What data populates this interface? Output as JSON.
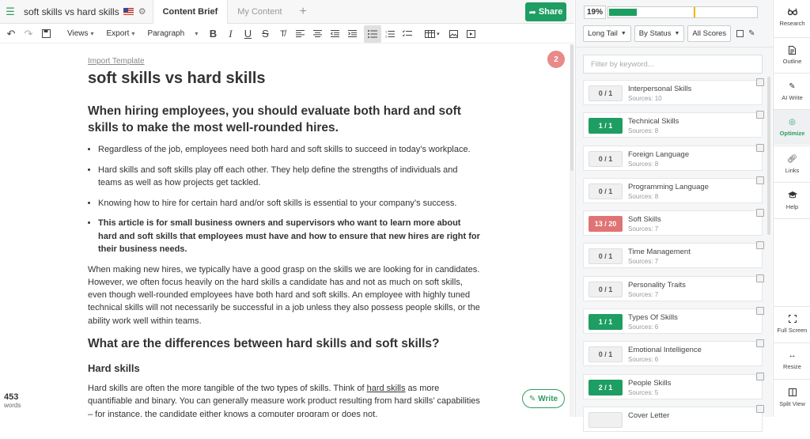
{
  "doc": {
    "title": "soft skills vs hard skills",
    "tabs": [
      "Content Brief",
      "My Content"
    ],
    "active_tab": 0,
    "share_label": "Share"
  },
  "toolbar": {
    "views_label": "Views",
    "export_label": "Export",
    "paragraph_label": "Paragraph"
  },
  "editor": {
    "import_link": "Import Template",
    "h1": "soft skills vs hard skills",
    "h2a": "When hiring employees, you should evaluate both hard and soft skills to make the most well-rounded hires.",
    "bullets": [
      "Regardless of the job, employees need both hard and soft skills to succeed in today’s workplace.",
      "Hard skills and soft skills play off each other. They help define the strengths of individuals and teams as well as how projects get tackled.",
      "Knowing how to hire for certain hard and/or soft skills is essential to your company’s success.",
      "This article is for small business owners and supervisors who want to learn more about hard and soft skills that employees must have and how to ensure that new hires are right for their business needs."
    ],
    "para1": "When making new hires, we typically have a good grasp on the skills we are looking for in candidates. However, we often focus heavily on the hard skills a candidate has and not as much on soft skills, even though well-rounded employees have both hard and soft skills. An employee with highly tuned technical skills will not necessarily be successful in a job unless they also possess people skills, or the ability work well within teams.",
    "h2b": "What are the differences between hard skills and soft skills?",
    "h3": "Hard skills",
    "para2_pre": "Hard skills are often the more tangible of the two types of skills. Think of ",
    "para2_link": "hard skills",
    "para2_post": " as more quantifiable and binary. You can generally measure work product resulting from hard skills’ capabilities – for instance, the candidate either knows a computer program or does not.",
    "comment_badge": "2",
    "word_count": "453",
    "word_label": "words",
    "write_label": "Write"
  },
  "panel": {
    "score": "19%",
    "score_fraction": 0.19,
    "target_fraction": 0.58,
    "filters": [
      "Long Tail",
      "By Status",
      "All Scores"
    ],
    "filter_placeholder": "Filter by keyword...",
    "keywords": [
      {
        "count": "0 / 1",
        "name": "Interpersonal Skills",
        "sources": "Sources: 10",
        "status": "none"
      },
      {
        "count": "1 / 1",
        "name": "Technical Skills",
        "sources": "Sources: 8",
        "status": "good"
      },
      {
        "count": "0 / 1",
        "name": "Foreign Language",
        "sources": "Sources: 8",
        "status": "none"
      },
      {
        "count": "0 / 1",
        "name": "Programming Language",
        "sources": "Sources: 8",
        "status": "none"
      },
      {
        "count": "13 / 20",
        "name": "Soft Skills",
        "sources": "Sources: 7",
        "status": "over"
      },
      {
        "count": "0 / 1",
        "name": "Time Management",
        "sources": "Sources: 7",
        "status": "none"
      },
      {
        "count": "0 / 1",
        "name": "Personality Traits",
        "sources": "Sources: 7",
        "status": "none"
      },
      {
        "count": "1 / 1",
        "name": "Types Of Skills",
        "sources": "Sources: 6",
        "status": "good"
      },
      {
        "count": "0 / 1",
        "name": "Emotional Intelligence",
        "sources": "Sources: 6",
        "status": "none"
      },
      {
        "count": "2 / 1",
        "name": "People Skills",
        "sources": "Sources: 5",
        "status": "good"
      },
      {
        "count": "",
        "name": "Cover Letter",
        "sources": "",
        "status": "none"
      }
    ]
  },
  "sidebar": {
    "items": [
      {
        "label": "Research",
        "icon": "research-icon"
      },
      {
        "label": "Outline",
        "icon": "outline-icon"
      },
      {
        "label": "AI Write",
        "icon": "ai-write-icon"
      },
      {
        "label": "Optimize",
        "icon": "optimize-icon"
      },
      {
        "label": "Links",
        "icon": "links-icon"
      },
      {
        "label": "Help",
        "icon": "help-icon"
      },
      {
        "label": "Full Screen",
        "icon": "fullscreen-icon"
      },
      {
        "label": "Resize",
        "icon": "resize-icon"
      },
      {
        "label": "Split View",
        "icon": "split-view-icon"
      }
    ],
    "active": 3
  },
  "colors": {
    "brand_green": "#1e9e62",
    "over_red": "#e07474",
    "target_yellow": "#f1b300",
    "comment_badge": "#e88a8a"
  }
}
